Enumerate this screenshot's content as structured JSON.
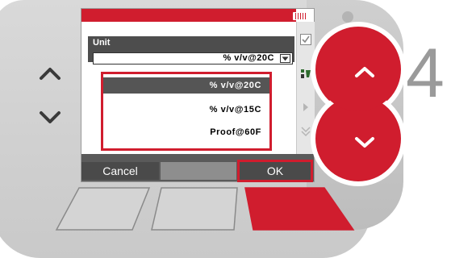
{
  "device": {
    "step_number": "4"
  },
  "dialog": {
    "title": "Unit",
    "selected_value": "% v/v@20C",
    "options": [
      {
        "label": "% v/v@20C",
        "selected": true
      },
      {
        "label": "% v/v@15C",
        "selected": false
      },
      {
        "label": "Proof@60F",
        "selected": false
      }
    ]
  },
  "softkeys": {
    "cancel": "Cancel",
    "middle": "",
    "ok": "OK"
  },
  "icons": {
    "battery": "battery-icon",
    "checkmark": "check-icon",
    "units": "unit-icon",
    "next": "right-arrow-icon",
    "scroll": "scroll-down-icon",
    "left_up": "chevron-up-icon",
    "left_down": "chevron-down-icon",
    "nav_up": "up-arrow-button",
    "nav_down": "down-arrow-button"
  },
  "colors": {
    "accent_red": "#d01d2e",
    "header_gray": "#4d4d4d",
    "number_gray": "#9a9a9a"
  }
}
